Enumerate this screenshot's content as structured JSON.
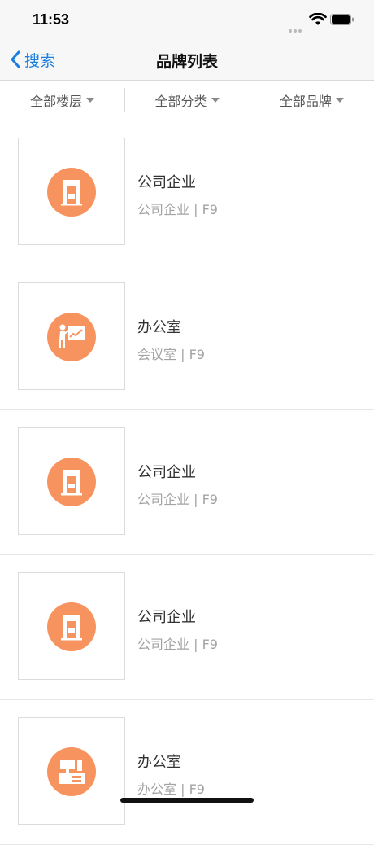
{
  "status_bar": {
    "time": "11:53"
  },
  "nav": {
    "back_label": "搜索",
    "title": "品牌列表"
  },
  "filters": [
    {
      "label": "全部楼层"
    },
    {
      "label": "全部分类"
    },
    {
      "label": "全部品牌"
    }
  ],
  "items": [
    {
      "name": "公司企业",
      "subtitle": "公司企业 | F9",
      "icon": "building-icon"
    },
    {
      "name": "办公室",
      "subtitle": "会议室 | F9",
      "icon": "presentation-icon"
    },
    {
      "name": "公司企业",
      "subtitle": "公司企业 | F9",
      "icon": "building-icon"
    },
    {
      "name": "公司企业",
      "subtitle": "公司企业 | F9",
      "icon": "building-icon"
    },
    {
      "name": "办公室",
      "subtitle": "办公室 | F9",
      "icon": "office-desk-icon"
    }
  ],
  "colors": {
    "accent": "#1a7fe0",
    "icon_bg": "#f7935e"
  }
}
